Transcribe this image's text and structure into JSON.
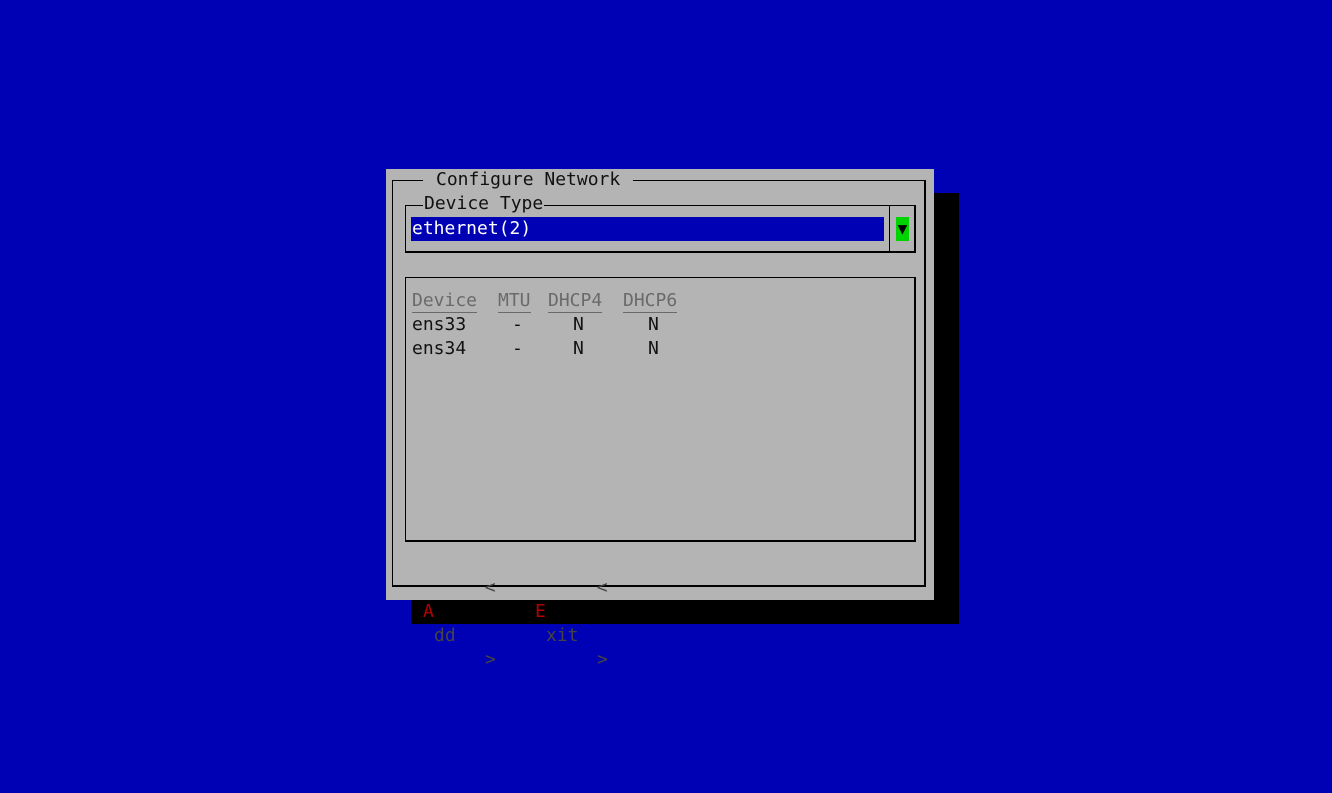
{
  "dialog": {
    "title": "Configure Network"
  },
  "device_type": {
    "label": "Device Type",
    "selected_value": "ethernet(2)",
    "dropdown_glyph": "▼"
  },
  "device_table": {
    "headers": [
      "Device",
      "MTU",
      "DHCP4",
      "DHCP6"
    ],
    "rows": [
      [
        "ens33",
        "-",
        "N",
        "N"
      ],
      [
        "ens34",
        "-",
        "N",
        "N"
      ]
    ]
  },
  "buttons": {
    "add": {
      "open": "<",
      "hotkey": "A",
      "rest": "dd",
      "close": ">"
    },
    "exit": {
      "open": "<",
      "hotkey": "E",
      "rest": "xit",
      "close": ">"
    }
  },
  "colors": {
    "background": "#0000b4",
    "dialog": "#b4b4b4",
    "shadow": "#000000",
    "selection": "#0000b4",
    "dropdown": "#00d400",
    "hotkey": "#b40000"
  }
}
